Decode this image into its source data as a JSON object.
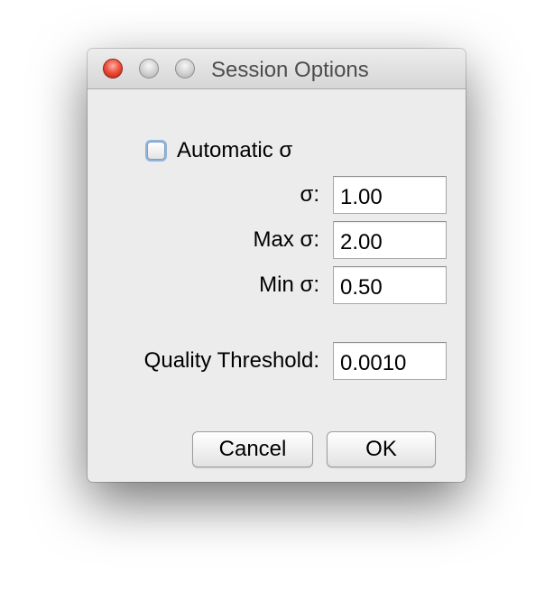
{
  "window": {
    "title": "Session Options"
  },
  "controls": {
    "automatic_sigma_label": "Automatic σ",
    "automatic_sigma_checked": false,
    "sigma_label": "σ:",
    "sigma_value": "1.00",
    "max_sigma_label": "Max σ:",
    "max_sigma_value": "2.00",
    "min_sigma_label": "Min σ:",
    "min_sigma_value": "0.50",
    "quality_threshold_label": "Quality Threshold:",
    "quality_threshold_value": "0.0010"
  },
  "buttons": {
    "cancel_label": "Cancel",
    "ok_label": "OK"
  },
  "colors": {
    "close_button": "#f0533f",
    "focus_ring": "#74a0d6",
    "window_background": "#ececec"
  }
}
